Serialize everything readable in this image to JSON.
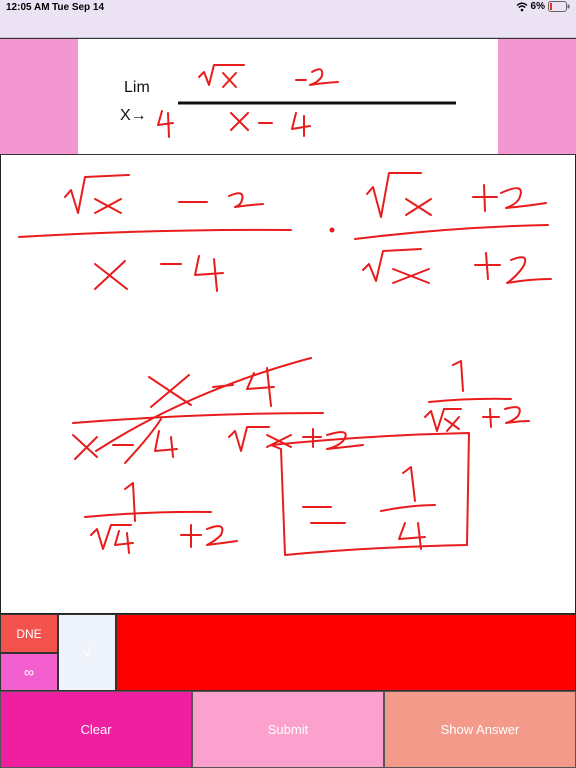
{
  "status_bar": {
    "time": "12:05 AM",
    "date": "Tue Sep 14",
    "battery": "6%",
    "wifi_icon": "wifi-icon",
    "battery_icon": "battery-icon"
  },
  "problem": {
    "lim_label": "Lim",
    "approach_prefix": "X→",
    "approach_value": "4",
    "numerator": "√x  − 2",
    "denominator": "x − 4"
  },
  "keypad": {
    "dne_label": "DNE",
    "infinity_label": "∞",
    "sqrt_label": "√",
    "answer_value": ""
  },
  "actions": {
    "clear_label": "Clear",
    "submit_label": "Submit",
    "show_answer_label": "Show Answer"
  },
  "colors": {
    "status_bg": "#ebe3f3",
    "side_panel": "#f497d0",
    "ink": "#e81c1c",
    "key_dne": "#f4534d",
    "key_infinity": "#f45fcf",
    "key_sqrt": "#eef3fc",
    "answer_field": "#ff0000",
    "clear": "#ee1fa1",
    "submit": "#fca0cd",
    "show_answer": "#f49a8b"
  }
}
